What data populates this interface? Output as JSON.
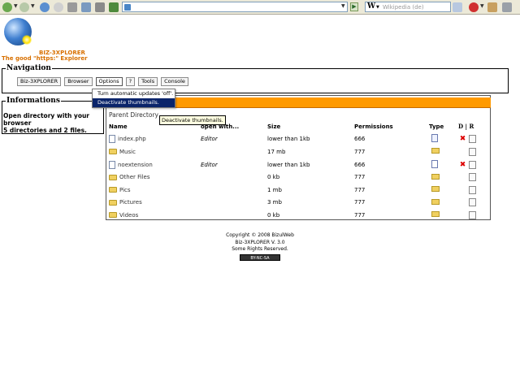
{
  "browser": {
    "url_value": "",
    "search_placeholder": "Wikipedia (de)"
  },
  "header": {
    "brand": "BIZ-3XPLORER",
    "tagline": "The good \"https:\" Explorer"
  },
  "navigation": {
    "legend": "Navigation",
    "buttons": [
      "Biz-3XPLORER",
      "Browser",
      "Options",
      "?",
      "Tools",
      "Console"
    ]
  },
  "options_menu": {
    "items": [
      "Turn automatic updates 'off'.",
      "Deactivate thumbnails."
    ]
  },
  "info": {
    "legend": "Informations",
    "line1": "Open directory with your browser",
    "line2": "5 directories and 2 files."
  },
  "listing": {
    "parent_dir": "Parent Directory",
    "tooltip": "Deactivate thumbnails.",
    "headers": {
      "name": "Name",
      "open_with": "open with...",
      "size": "Size",
      "permissions": "Permissions",
      "type": "Type",
      "dr": "D | R"
    },
    "rows": [
      {
        "name": "index.php",
        "open_with": "Editor",
        "size": "lower than 1kb",
        "perm": "666",
        "type": "file",
        "deletable": true
      },
      {
        "name": "Music",
        "open_with": "",
        "size": "17 mb",
        "perm": "777",
        "type": "folder",
        "deletable": false
      },
      {
        "name": "noextension",
        "open_with": "Editor",
        "size": "lower than 1kb",
        "perm": "666",
        "type": "file",
        "deletable": true
      },
      {
        "name": "Other Files",
        "open_with": "",
        "size": "0 kb",
        "perm": "777",
        "type": "folder",
        "deletable": false
      },
      {
        "name": "Pics",
        "open_with": "",
        "size": "1 mb",
        "perm": "777",
        "type": "folder",
        "deletable": false
      },
      {
        "name": "Pictures",
        "open_with": "",
        "size": "3 mb",
        "perm": "777",
        "type": "folder",
        "deletable": false
      },
      {
        "name": "Videos",
        "open_with": "",
        "size": "0 kb",
        "perm": "777",
        "type": "folder",
        "deletable": false
      }
    ]
  },
  "footer": {
    "copyright": "Copyright © 2008 BizulWeb",
    "version": "Biz-3XPLORER V. 3.0",
    "rights": "Some Rights Reserved.",
    "cc_badge": "BY-NC-SA"
  }
}
